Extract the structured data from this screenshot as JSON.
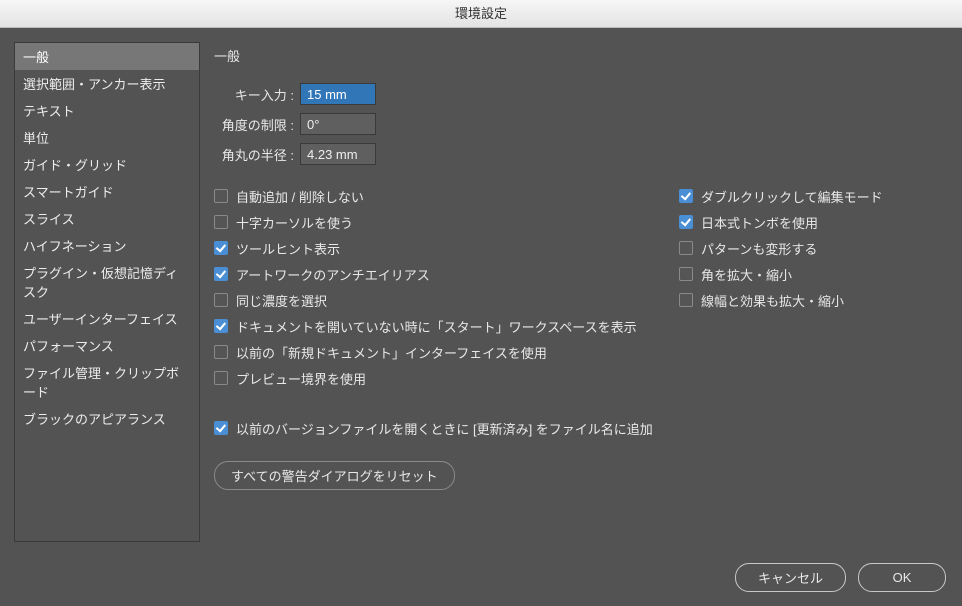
{
  "title": "環境設定",
  "sidebar": {
    "items": [
      "一般",
      "選択範囲・アンカー表示",
      "テキスト",
      "単位",
      "ガイド・グリッド",
      "スマートガイド",
      "スライス",
      "ハイフネーション",
      "プラグイン・仮想記憶ディスク",
      "ユーザーインターフェイス",
      "パフォーマンス",
      "ファイル管理・クリップボード",
      "ブラックのアピアランス"
    ],
    "selected_index": 0
  },
  "main": {
    "section_title": "一般",
    "fields": {
      "key_input": {
        "label": "キー入力 :",
        "value": "15 mm",
        "highlight": true
      },
      "angle_limit": {
        "label": "角度の制限 :",
        "value": "0°",
        "highlight": false
      },
      "corner_radius": {
        "label": "角丸の半径 :",
        "value": "4.23 mm",
        "highlight": false
      }
    },
    "left_checks": [
      {
        "label": "自動追加 / 削除しない",
        "checked": false
      },
      {
        "label": "十字カーソルを使う",
        "checked": false
      },
      {
        "label": "ツールヒント表示",
        "checked": true
      },
      {
        "label": "アートワークのアンチエイリアス",
        "checked": true
      },
      {
        "label": "同じ濃度を選択",
        "checked": false
      },
      {
        "label": "ドキュメントを開いていない時に「スタート」ワークスペースを表示",
        "checked": true
      },
      {
        "label": "以前の「新規ドキュメント」インターフェイスを使用",
        "checked": false
      },
      {
        "label": "プレビュー境界を使用",
        "checked": false
      }
    ],
    "left_extra": {
      "label": "以前のバージョンファイルを開くときに [更新済み] をファイル名に追加",
      "checked": true
    },
    "right_checks": [
      {
        "label": "ダブルクリックして編集モード",
        "checked": true
      },
      {
        "label": "日本式トンボを使用",
        "checked": true
      },
      {
        "label": "パターンも変形する",
        "checked": false
      },
      {
        "label": "角を拡大・縮小",
        "checked": false
      },
      {
        "label": "線幅と効果も拡大・縮小",
        "checked": false
      }
    ],
    "reset_button": "すべての警告ダイアログをリセット"
  },
  "footer": {
    "cancel": "キャンセル",
    "ok": "OK"
  }
}
